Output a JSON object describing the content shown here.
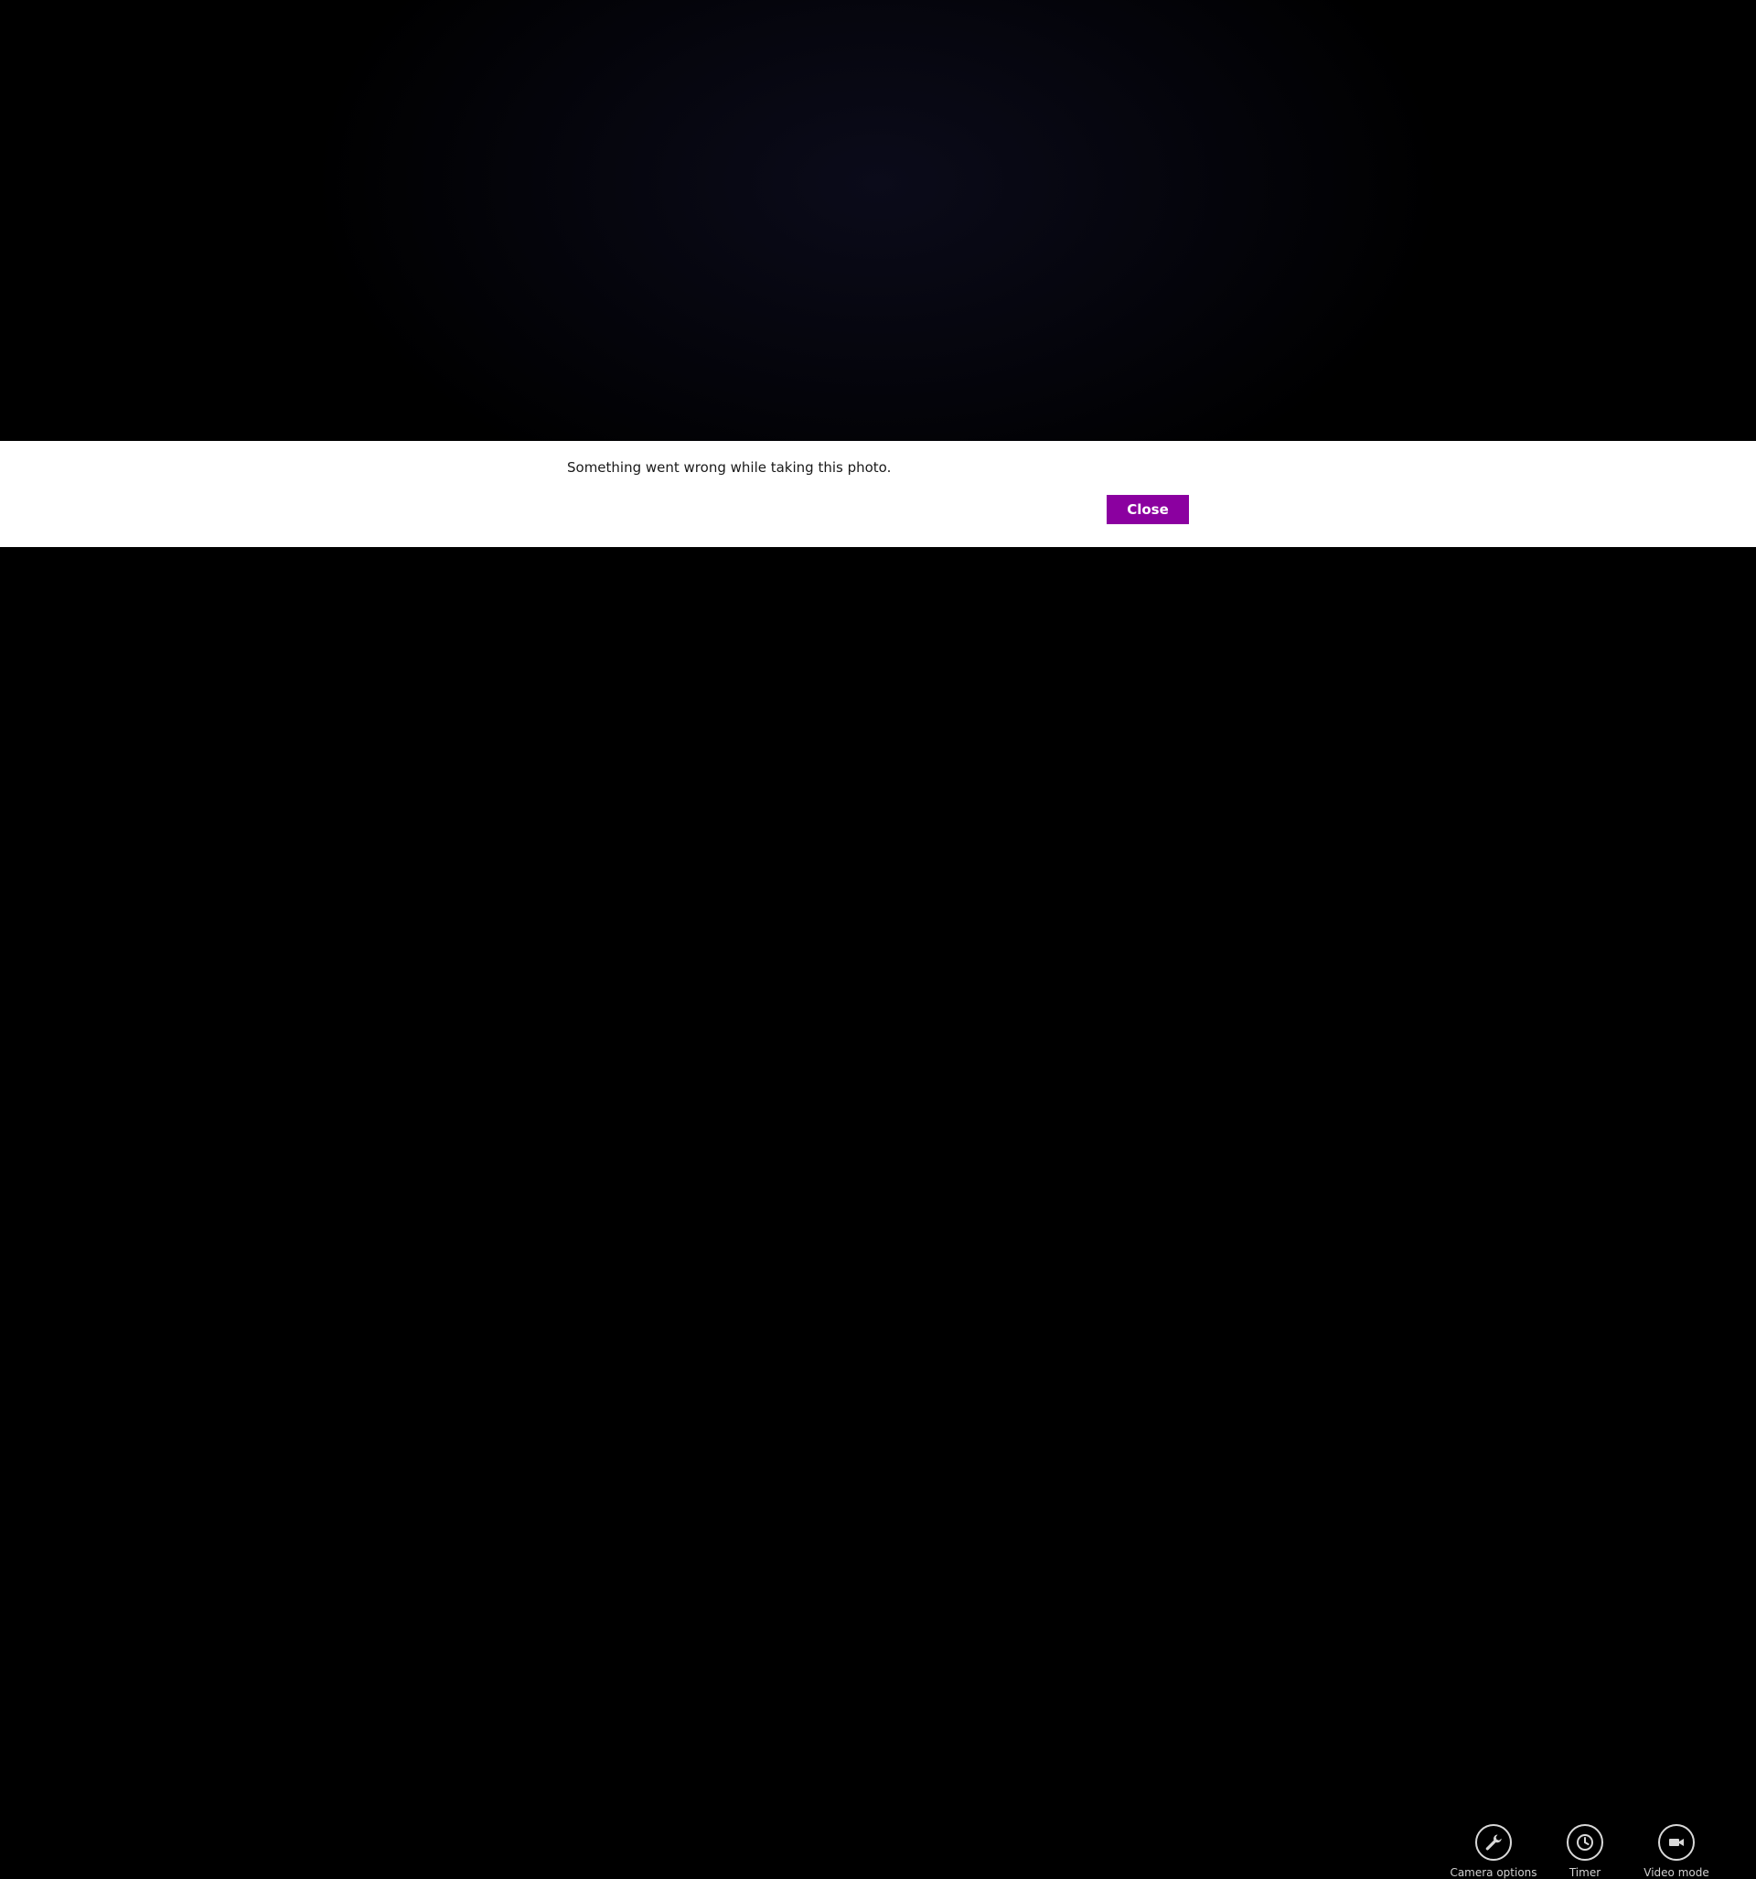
{
  "dialog": {
    "message": "Something went wrong while taking this photo.",
    "close_label": "Close"
  },
  "appbar": {
    "camera_options_label": "Camera options",
    "camera_options_icon": "wrench-icon",
    "timer_label": "Timer",
    "timer_icon": "clock-icon",
    "video_mode_label": "Video mode",
    "video_mode_icon": "video-camera-icon"
  },
  "colors": {
    "accent": "#8b00a0",
    "dialog_background": "#ffffff",
    "app_background": "#000000"
  }
}
